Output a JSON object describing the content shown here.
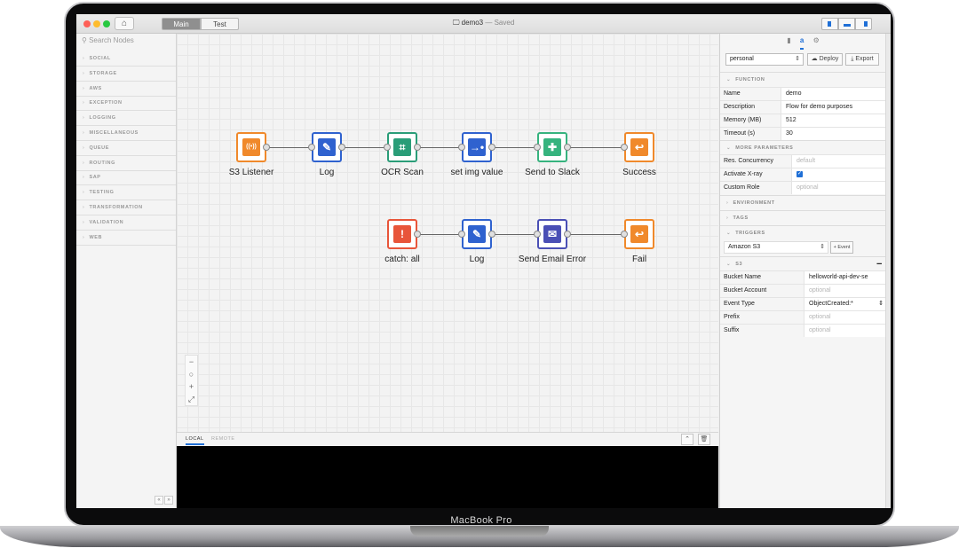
{
  "device": {
    "brand": "MacBook Pro"
  },
  "window": {
    "title": "demo3",
    "status": "— Saved",
    "mode_tabs": [
      "Main",
      "Test"
    ],
    "active_mode": "Main"
  },
  "sidebar": {
    "search_placeholder": "Search Nodes",
    "categories": [
      "SOCIAL",
      "STORAGE",
      "AWS",
      "EXCEPTION",
      "LOGGING",
      "MISCELLANEOUS",
      "QUEUE",
      "ROUTING",
      "SAP",
      "TESTING",
      "TRANSFORMATION",
      "VALIDATION",
      "WEB"
    ]
  },
  "flow": {
    "main_row": [
      {
        "label": "S3 Listener",
        "icon": "broadcast-icon",
        "color": "#f0892b"
      },
      {
        "label": "Log",
        "icon": "pencil-icon",
        "color": "#2f62cf"
      },
      {
        "label": "OCR Scan",
        "icon": "scan-icon",
        "color": "#2a9d78"
      },
      {
        "label": "set img value",
        "icon": "arrow-dots-icon",
        "color": "#2f62cf"
      },
      {
        "label": "Send to Slack",
        "icon": "slack-icon",
        "color": "#36b37e"
      },
      {
        "label": "Success",
        "icon": "reply-icon",
        "color": "#f0892b"
      }
    ],
    "error_row": [
      {
        "label": "catch: all",
        "icon": "warning-icon",
        "color": "#e8553a"
      },
      {
        "label": "Log",
        "icon": "pencil-icon",
        "color": "#2f62cf"
      },
      {
        "label": "Send Email Error",
        "icon": "email-icon",
        "color": "#4a4fb5"
      },
      {
        "label": "Fail",
        "icon": "reply-icon",
        "color": "#f0892b"
      }
    ]
  },
  "console": {
    "tabs": [
      "LOCAL",
      "REMOTE"
    ],
    "active_tab": "LOCAL"
  },
  "panel": {
    "profile": "personal",
    "deploy_label": "Deploy",
    "export_label": "Export",
    "function_title": "FUNCTION",
    "function_rows": [
      {
        "key": "Name",
        "value": "demo"
      },
      {
        "key": "Description",
        "value": "Flow for demo purposes"
      },
      {
        "key": "Memory (MB)",
        "value": "512"
      },
      {
        "key": "Timeout (s)",
        "value": "30"
      }
    ],
    "more_params_title": "MORE PARAMETERS",
    "res_concurrency": {
      "key": "Res. Concurrency",
      "placeholder": "default"
    },
    "xray": {
      "key": "Activate X-ray",
      "checked": true
    },
    "custom_role": {
      "key": "Custom Role",
      "placeholder": "optional"
    },
    "environment_title": "ENVIRONMENT",
    "tags_title": "TAGS",
    "triggers_title": "TRIGGERS",
    "trigger_select": "Amazon S3",
    "add_event_label": "+ Event",
    "s3_title": "S3",
    "s3_rows": [
      {
        "key": "Bucket Name",
        "value": "helloworld-api-dev-se",
        "placeholder": ""
      },
      {
        "key": "Bucket Account",
        "value": "",
        "placeholder": "optional"
      },
      {
        "key": "Event Type",
        "value": "ObjectCreated:*",
        "placeholder": ""
      },
      {
        "key": "Prefix",
        "value": "",
        "placeholder": "optional"
      },
      {
        "key": "Suffix",
        "value": "",
        "placeholder": "optional"
      }
    ]
  },
  "colors": {
    "accent": "#1f6fd6",
    "console_bg": "#000000"
  }
}
